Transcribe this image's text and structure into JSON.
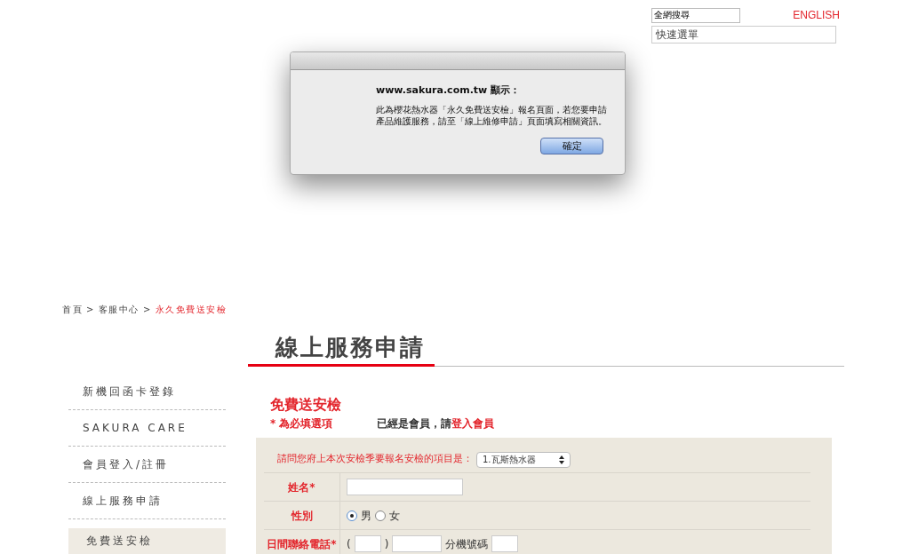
{
  "header": {
    "search_field": {
      "value": "全網搜尋"
    },
    "language_link": "ENGLISH",
    "quick_menu": {
      "value": "快速選單"
    }
  },
  "dialog": {
    "source": "www.sakura.com.tw 顯示：",
    "message": "此為櫻花熱水器「永久免費送安檢」報名頁面，若您要申請產品維護服務，請至「線上維修申請」頁面填寫相關資訊。",
    "button": "確定"
  },
  "breadcrumb": [
    {
      "label": "首頁",
      "current": false
    },
    {
      "label": "客服中心",
      "current": false
    },
    {
      "label": "永久免費送安檢",
      "current": true
    }
  ],
  "breadcrumb_separator": ">",
  "page_title": "線上服務申請",
  "sidebar": {
    "items": [
      {
        "label": "新機回函卡登錄",
        "selected": false
      },
      {
        "label": "SAKURA CARE",
        "selected": false
      },
      {
        "label": "會員登入/註冊",
        "selected": false
      },
      {
        "label": "線上服務申請",
        "selected": false
      },
      {
        "label": "免費送安檢",
        "selected": true
      }
    ]
  },
  "form": {
    "heading": "免費送安檢",
    "required_note": "* 為必填選項",
    "member_prompt": "已經是會員，請",
    "login_link": "登入會員",
    "question": {
      "label": "請問您府上本次安檢季要報名安檢的項目是：",
      "value": "1.瓦斯熱水器"
    },
    "rows": [
      {
        "kind": "text",
        "label": "姓名*"
      },
      {
        "kind": "radio",
        "label": "性別",
        "options": [
          {
            "label": "男",
            "selected": true
          },
          {
            "label": "女",
            "selected": false
          }
        ]
      },
      {
        "kind": "phone",
        "label": "日間聯絡電話*",
        "open_paren": "(",
        "close_paren": ")",
        "extension_label": "分機號碼"
      }
    ]
  }
}
